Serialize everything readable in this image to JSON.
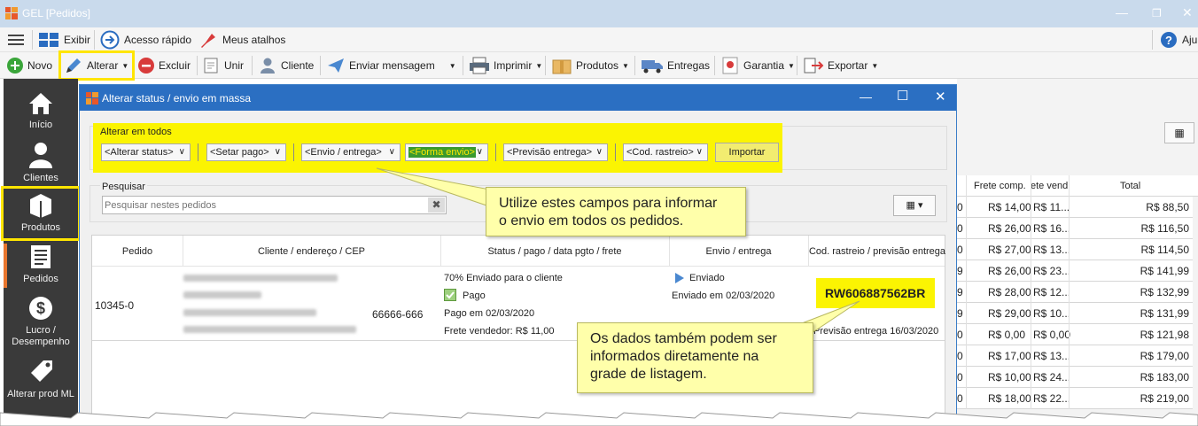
{
  "window": {
    "title": "GEL [Pedidos]",
    "min": "—",
    "restore": "❐",
    "close": "✕"
  },
  "menubar": {
    "exibir": "Exibir",
    "acesso_rapido": "Acesso rápido",
    "meus_atalhos": "Meus atalhos",
    "ajuda": "Aju"
  },
  "toolbar": {
    "novo": "Novo",
    "alterar": "Alterar",
    "excluir": "Excluir",
    "unir": "Unir",
    "cliente": "Cliente",
    "enviar_mensagem": "Enviar mensagem",
    "imprimir": "Imprimir",
    "produtos": "Produtos",
    "entregas": "Entregas",
    "garantia": "Garantia",
    "exportar": "Exportar"
  },
  "sidebar": {
    "inicio": "Início",
    "clientes": "Clientes",
    "produtos": "Produtos",
    "pedidos": "Pedidos",
    "lucro": "Lucro /",
    "desempenho": "Desempenho",
    "alterar_prod": "Alterar prod ML"
  },
  "right_table": {
    "headers": {
      "frete_comp": "Frete comp.",
      "frete_vend": "ete vend",
      "total": "Total"
    },
    "rows": [
      {
        "c0": "0",
        "frete_comp": "R$ 14,00",
        "frete_vend": "R$ 11...",
        "total": "R$ 88,50"
      },
      {
        "c0": "0",
        "frete_comp": "R$ 26,00",
        "frete_vend": "R$ 16...",
        "total": "R$ 116,50"
      },
      {
        "c0": "0",
        "frete_comp": "R$ 27,00",
        "frete_vend": "R$ 13...",
        "total": "R$ 114,50"
      },
      {
        "c0": "9",
        "frete_comp": "R$ 26,00",
        "frete_vend": "R$ 23...",
        "total": "R$ 141,99"
      },
      {
        "c0": "9",
        "frete_comp": "R$ 28,00",
        "frete_vend": "R$ 12...",
        "total": "R$ 132,99"
      },
      {
        "c0": "9",
        "frete_comp": "R$ 29,00",
        "frete_vend": "R$ 10...",
        "total": "R$ 131,99"
      },
      {
        "c0": "0",
        "frete_comp": "R$ 0,00",
        "frete_vend": "R$ 0,00",
        "total": "R$ 121,98"
      },
      {
        "c0": "0",
        "frete_comp": "R$ 17,00",
        "frete_vend": "R$ 13...",
        "total": "R$ 179,00"
      },
      {
        "c0": "0",
        "frete_comp": "R$ 10,00",
        "frete_vend": "R$ 24...",
        "total": "R$ 183,00"
      },
      {
        "c0": "0",
        "frete_comp": "R$ 18,00",
        "frete_vend": "R$ 22...",
        "total": "R$ 219,00"
      }
    ]
  },
  "modal": {
    "title": "Alterar status / envio em massa",
    "group_label": "Alterar em todos",
    "dropdowns": {
      "status": "<Alterar status>",
      "pago": "<Setar pago>",
      "envio": "<Envio / entrega>",
      "forma": "<Forma envio>",
      "previsao": "<Previsão entrega>",
      "rastreio": "<Cod. rastreio>"
    },
    "importar": "Importar",
    "search_label": "Pesquisar",
    "search_placeholder": "Pesquisar nestes pedidos",
    "grid_headers": {
      "pedido": "Pedido",
      "cliente": "Cliente / endereço / CEP",
      "status": "Status / pago / data pgto / frete",
      "envio": "Envio / entrega",
      "rastreio": "Cod. rastreio / previsão entrega"
    },
    "row": {
      "pedido": "10345-0",
      "cep": "66666-666",
      "status_pct": "70% Enviado para o cliente",
      "pago": "Pago",
      "pago_em": "Pago em 02/03/2020",
      "frete_vendedor": "Frete vendedor: R$ 11,00",
      "envio_status": "Enviado",
      "enviado_em": "Enviado em 02/03/2020",
      "rastreio": "RW606887562BR",
      "previsao": "Previsão entrega 16/03/2020"
    }
  },
  "callouts": {
    "top": [
      "Utilize estes campos para informar",
      "o envio em todos os pedidos."
    ],
    "bottom": [
      "Os dados também podem ser",
      "informados diretamente na",
      "grade de listagem."
    ]
  },
  "colors": {
    "titlebar": "#c9daec",
    "modal_title": "#2b6fc2",
    "sidebar": "#3a3a3a",
    "highlight": "#ffe500"
  }
}
